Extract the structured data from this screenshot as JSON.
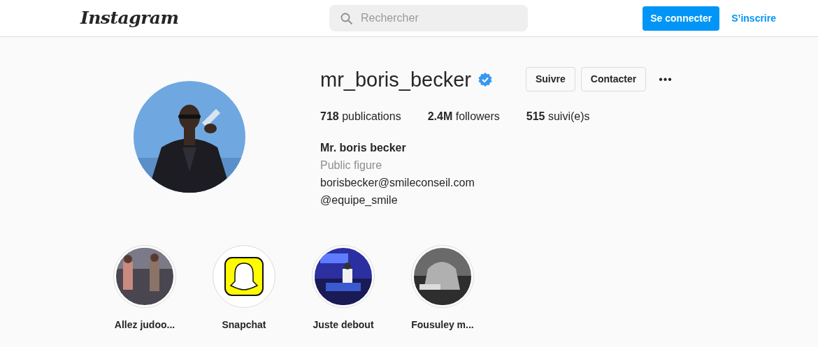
{
  "header": {
    "logo": "Instagram",
    "search": {
      "placeholder": "Rechercher"
    },
    "login_button": "Se connecter",
    "signup_link": "S’inscrire"
  },
  "profile": {
    "username": "mr_boris_becker",
    "verified": true,
    "buttons": [
      "Suivre",
      "Contacter"
    ],
    "more": "•••",
    "stats": [
      {
        "count": "718",
        "label": "publications"
      },
      {
        "count": "2.4M",
        "label": "followers"
      },
      {
        "count": "515",
        "label": "suivi(e)s"
      }
    ],
    "full_name": "Mr. boris becker",
    "category": "Public figure",
    "bio": [
      "borisbecker@smileconseil.com",
      "@equipe_smile"
    ]
  },
  "highlights": [
    {
      "label": "Allez judoo..."
    },
    {
      "label": "Snapchat"
    },
    {
      "label": "Juste debout"
    },
    {
      "label": "Fousuley m..."
    }
  ]
}
